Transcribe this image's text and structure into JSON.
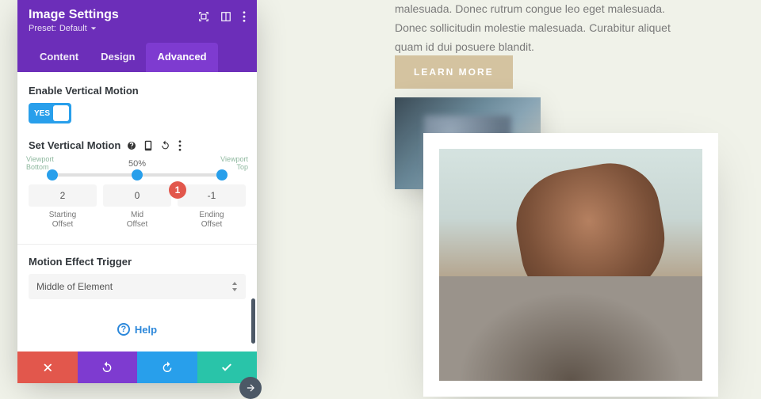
{
  "page": {
    "paragraph": "malesuada. Donec rutrum congue leo eget malesuada. Donec sollicitudin molestie malesuada. Curabitur aliquet quam id dui posuere blandit.",
    "cta": "LEARN MORE"
  },
  "panel": {
    "title": "Image Settings",
    "preset_label": "Preset:",
    "preset_value": "Default",
    "tabs": {
      "content": "Content",
      "design": "Design",
      "advanced": "Advanced"
    }
  },
  "motion": {
    "enable_label": "Enable Vertical Motion",
    "toggle_yes": "YES",
    "set_label": "Set Vertical Motion",
    "percent": "50%",
    "viewport_bottom": "Viewport\nBottom",
    "viewport_top": "Viewport\nTop",
    "offsets": {
      "start_val": "2",
      "start_lab": "Starting\nOffset",
      "mid_val": "0",
      "mid_lab": "Mid\nOffset",
      "end_val": "-1",
      "end_lab": "Ending\nOffset"
    },
    "badge": "1"
  },
  "trigger": {
    "label": "Motion Effect Trigger",
    "value": "Middle of Element"
  },
  "help": "Help"
}
